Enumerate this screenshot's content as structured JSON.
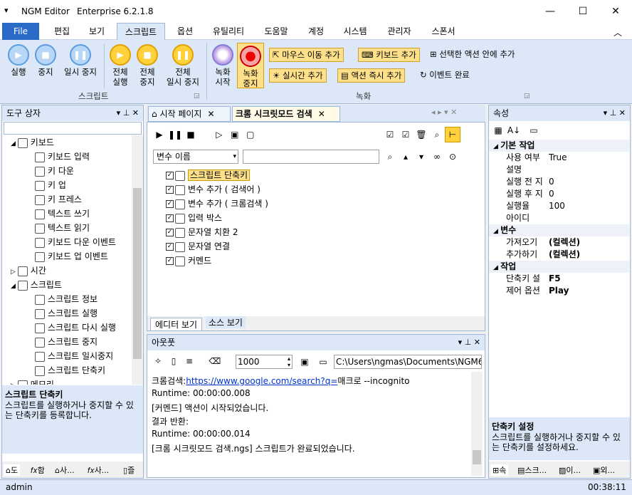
{
  "window": {
    "sys_icon": "▾",
    "app_name": "NGM Editor",
    "version": "Enterprise 6.2.1.8",
    "min": "—",
    "max": "☐",
    "close": "✕"
  },
  "menu": {
    "file": "File",
    "tabs": [
      "편집",
      "보기",
      "스크립트",
      "옵션",
      "유틸리티",
      "도움말",
      "계정",
      "시스템",
      "관리자",
      "스폰서"
    ]
  },
  "ribbon": {
    "script_group": {
      "label": "스크립트",
      "run": "실행",
      "stop": "중지",
      "pause": "일시 중지",
      "run_all_1": "전체",
      "run_all_2": "실행",
      "stop_all_1": "전체",
      "stop_all_2": "중지",
      "pause_all_1": "전체",
      "pause_all_2": "일시 중지"
    },
    "record_group": {
      "label": "녹화",
      "start_1": "녹화",
      "start_2": "시작",
      "stop_1": "녹화",
      "stop_2": "중지",
      "mouse_move": "마우스 이동 추가",
      "keyboard": "키보드 추가",
      "selected_action": "선택한 액션 안에 추가",
      "realtime": "실시간 추가",
      "immediate": "액션 즉시 추가",
      "event_done": "이벤트 완료"
    }
  },
  "toolbox": {
    "title": "도구 상자",
    "search_placeholder": "",
    "items": [
      {
        "label": "키보드",
        "level": 0,
        "expand": "◢"
      },
      {
        "label": "키보드 입력",
        "level": 1
      },
      {
        "label": "키 다운",
        "level": 1
      },
      {
        "label": "키 업",
        "level": 1
      },
      {
        "label": "키 프레스",
        "level": 1
      },
      {
        "label": "텍스트 쓰기",
        "level": 1
      },
      {
        "label": "텍스트 읽기",
        "level": 1
      },
      {
        "label": "키보드 다운 이벤트",
        "level": 1
      },
      {
        "label": "키보드 업 이벤트",
        "level": 1
      },
      {
        "label": "시간",
        "level": 0,
        "expand": "▷"
      },
      {
        "label": "스크립트",
        "level": 0,
        "expand": "◢"
      },
      {
        "label": "스크립트 정보",
        "level": 1
      },
      {
        "label": "스크립트 실행",
        "level": 1
      },
      {
        "label": "스크립트 다시 실행",
        "level": 1
      },
      {
        "label": "스크립트 중지",
        "level": 1
      },
      {
        "label": "스크립트 일시중지",
        "level": 1
      },
      {
        "label": "스크립트 단축키",
        "level": 1
      },
      {
        "label": "메모리",
        "level": 0,
        "expand": "▷"
      }
    ],
    "desc_title": "스크립트 단축키",
    "desc_text": "스크립트를 실행하거나 중지할 수 있는 단축키를 등록합니다.",
    "bottom_tabs": [
      "도",
      "함",
      "사...",
      "사...",
      "즐"
    ]
  },
  "editor": {
    "tabs": [
      "시작 페이지",
      "크롬 시크릿모드 검색"
    ],
    "var_select": "변수 이름",
    "var_search": "",
    "actions": [
      {
        "label": "스크립트 단축키",
        "selected": true
      },
      {
        "label": "변수 추가 ( 검색어 )",
        "selected": false
      },
      {
        "label": "변수 추가 ( 크롬검색 )",
        "selected": false
      },
      {
        "label": "입력 박스",
        "selected": false
      },
      {
        "label": "문자열 치환 2",
        "selected": false
      },
      {
        "label": "문자열 연결",
        "selected": false
      },
      {
        "label": "커멘드",
        "selected": false
      }
    ],
    "bottom_tabs": [
      "에디터 보기",
      "소스 보기"
    ]
  },
  "output": {
    "title": "아웃풋",
    "count": "1000",
    "path": "C:\\Users\\ngmas\\Documents\\NGM6\\",
    "lines": [
      {
        "prefix": "크롬검색:",
        "link": "https://www.google.com/search?q=",
        "suffix": "매크로 --incognito"
      },
      {
        "prefix": "Runtime: 00:00:00.008",
        "link": "",
        "suffix": ""
      },
      {
        "prefix": "[커멘드] 액션이 시작되었습니다.",
        "link": "",
        "suffix": ""
      },
      {
        "prefix": "결과 반환:",
        "link": "",
        "suffix": ""
      },
      {
        "prefix": "Runtime: 00:00:00.014",
        "link": "",
        "suffix": ""
      },
      {
        "prefix": "[크롬 시크릿모드 검색.ngs] 스크립트가 완료되었습니다.",
        "link": "",
        "suffix": ""
      }
    ]
  },
  "properties": {
    "title": "속성",
    "cat_basic": "기본 작업",
    "rows_basic": [
      {
        "k": "사용 여부",
        "v": "True"
      },
      {
        "k": "설명",
        "v": ""
      },
      {
        "k": "실행 전 지",
        "v": "0"
      },
      {
        "k": "실행 후 지",
        "v": "0"
      },
      {
        "k": "실행율",
        "v": "100"
      },
      {
        "k": "아이디",
        "v": ""
      }
    ],
    "cat_var": "변수",
    "rows_var": [
      {
        "k": "가져오기",
        "v": "(컬렉션)"
      },
      {
        "k": "추가하기",
        "v": "(컬렉션)"
      }
    ],
    "cat_action": "작업",
    "rows_action": [
      {
        "k": "단축키 설",
        "v": "F5"
      },
      {
        "k": "제어 옵션",
        "v": "Play"
      }
    ],
    "desc_title": "단축키 설정",
    "desc_text": "스크립트를 실행하거나 중지할 수 있는 단축키를 설정하세요.",
    "bottom_tabs": [
      "속",
      "스크...",
      "이...",
      "외..."
    ]
  },
  "status": {
    "user": "admin",
    "time": "00:38:11"
  }
}
